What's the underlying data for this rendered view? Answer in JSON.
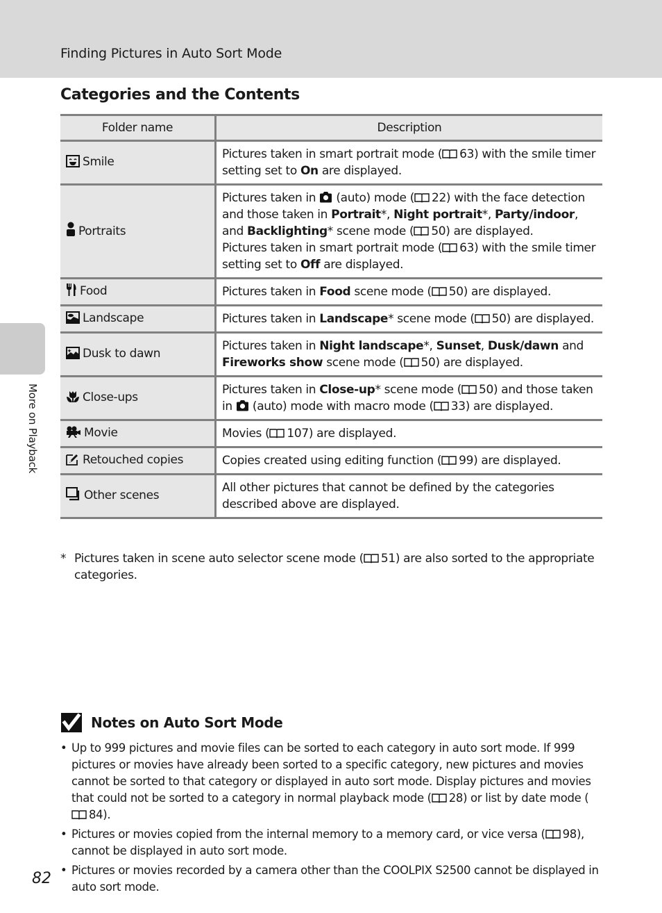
{
  "header": {
    "running_head": "Finding Pictures in Auto Sort Mode"
  },
  "section_title": "Categories and the Contents",
  "side_tab": {
    "label": "More on Playback"
  },
  "table": {
    "columns": [
      "Folder name",
      "Description"
    ],
    "rows": [
      {
        "icon": "smile-icon",
        "name": "Smile",
        "desc": [
          {
            "t": "Pictures taken in smart portrait mode ("
          },
          {
            "ref": "63"
          },
          {
            "t": ") with the smile timer setting set to "
          },
          {
            "b": "On"
          },
          {
            "t": " are displayed."
          }
        ]
      },
      {
        "icon": "portrait-icon",
        "name": "Portraits",
        "desc": [
          {
            "t": "Pictures taken in "
          },
          {
            "cam": "auto"
          },
          {
            "t": " (auto) mode ("
          },
          {
            "ref": "22"
          },
          {
            "t": ") with the face detection and those taken in "
          },
          {
            "b": "Portrait"
          },
          {
            "t": "*, "
          },
          {
            "b": "Night portrait"
          },
          {
            "t": "*, "
          },
          {
            "b": "Party/indoor"
          },
          {
            "t": ", and "
          },
          {
            "b": "Backlighting"
          },
          {
            "t": "* scene mode ("
          },
          {
            "ref": "50"
          },
          {
            "t": ") are displayed."
          },
          {
            "br": true
          },
          {
            "t": "Pictures taken in smart portrait mode ("
          },
          {
            "ref": "63"
          },
          {
            "t": ") with the smile timer setting set to "
          },
          {
            "b": "Off"
          },
          {
            "t": " are displayed."
          }
        ]
      },
      {
        "icon": "food-icon",
        "name": "Food",
        "desc": [
          {
            "t": "Pictures taken in "
          },
          {
            "b": "Food"
          },
          {
            "t": " scene mode ("
          },
          {
            "ref": "50"
          },
          {
            "t": ") are displayed."
          }
        ]
      },
      {
        "icon": "landscape-icon",
        "name": "Landscape",
        "desc": [
          {
            "t": "Pictures taken in "
          },
          {
            "b": "Landscape"
          },
          {
            "t": "* scene mode ("
          },
          {
            "ref": "50"
          },
          {
            "t": ") are displayed."
          }
        ]
      },
      {
        "icon": "dusk-to-dawn-icon",
        "name": "Dusk to dawn",
        "desc": [
          {
            "t": "Pictures taken in "
          },
          {
            "b": "Night landscape"
          },
          {
            "t": "*, "
          },
          {
            "b": "Sunset"
          },
          {
            "t": ", "
          },
          {
            "b": "Dusk/dawn"
          },
          {
            "t": " and "
          },
          {
            "b": "Fireworks show"
          },
          {
            "t": " scene mode ("
          },
          {
            "ref": "50"
          },
          {
            "t": ") are displayed."
          }
        ]
      },
      {
        "icon": "close-up-flower-icon",
        "name": "Close-ups",
        "desc": [
          {
            "t": "Pictures taken in "
          },
          {
            "b": "Close-up"
          },
          {
            "t": "* scene mode ("
          },
          {
            "ref": "50"
          },
          {
            "t": ") and those taken in "
          },
          {
            "cam": "auto"
          },
          {
            "t": " (auto) mode with macro mode ("
          },
          {
            "ref": "33"
          },
          {
            "t": ") are displayed."
          }
        ]
      },
      {
        "icon": "movie-camera-icon",
        "name": "Movie",
        "desc": [
          {
            "t": "Movies ("
          },
          {
            "ref": "107"
          },
          {
            "t": ") are displayed."
          }
        ]
      },
      {
        "icon": "retouch-icon",
        "name": "Retouched copies",
        "desc": [
          {
            "t": "Copies created using editing function ("
          },
          {
            "ref": "99"
          },
          {
            "t": ") are displayed."
          }
        ]
      },
      {
        "icon": "other-scenes-icon",
        "name": "Other scenes",
        "desc": [
          {
            "t": "All other pictures that cannot be defined by the categories described above are displayed."
          }
        ]
      }
    ]
  },
  "footnote": {
    "marker": "*",
    "parts": [
      {
        "t": "Pictures taken in scene auto selector scene mode ("
      },
      {
        "ref": "51"
      },
      {
        "t": ") are also sorted to the appropriate categories."
      }
    ]
  },
  "notes": {
    "icon": "check-mark-icon",
    "title": "Notes on Auto Sort Mode",
    "bullet": "•",
    "items": [
      [
        {
          "t": "Up to 999 pictures and movie files can be sorted to each category in auto sort mode. If 999 pictures or movies have already been sorted to a specific category, new pictures and movies cannot be sorted to that category or displayed in auto sort mode. Display pictures and movies that could not be sorted to a category in normal playback mode ("
        },
        {
          "ref": "28"
        },
        {
          "t": ") or list by date mode ("
        },
        {
          "ref": "84"
        },
        {
          "t": ")."
        }
      ],
      [
        {
          "t": "Pictures or movies copied from the internal memory to a memory card, or vice versa ("
        },
        {
          "ref": "98"
        },
        {
          "t": "), cannot be displayed in auto sort mode."
        }
      ],
      [
        {
          "t": "Pictures or movies recorded by a camera other than the COOLPIX S2500 cannot be displayed in auto sort mode."
        }
      ]
    ]
  },
  "page_number": "82"
}
